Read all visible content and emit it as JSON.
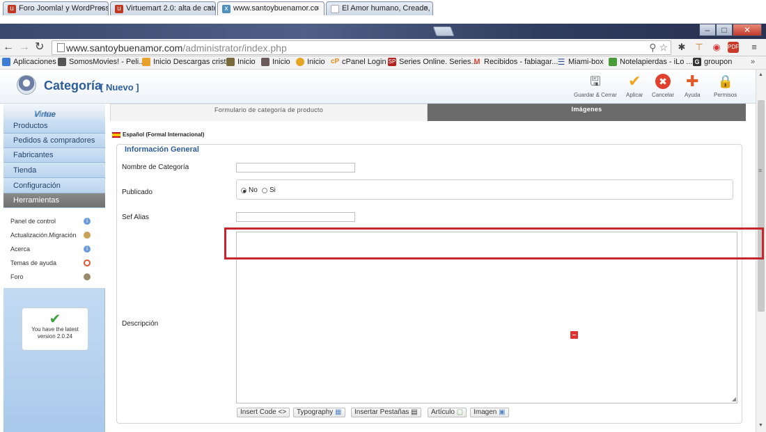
{
  "browser": {
    "tabs": [
      {
        "title": "Foro Joomla! y WordPress",
        "fav": "u",
        "fav_color": "#c3361f"
      },
      {
        "title": "Virtuemart 2.0: alta de cate",
        "fav": "u",
        "fav_color": "#c3361f"
      },
      {
        "title": "www.santoybuenamor.co",
        "fav": "x",
        "fav_color": "#4f8fbf"
      },
      {
        "title": "El Amor humano, Creado,",
        "fav": "",
        "fav_color": "#bbb"
      }
    ],
    "url_host": "www.santoybuenamor.com",
    "url_path": "/administrator/index.php",
    "bookmarks": [
      {
        "label": "Aplicaciones",
        "icon": "apps-icon",
        "color": "#3b7dd8"
      },
      {
        "label": "SomosMovies! - Peli...",
        "icon": "movie-icon",
        "color": "#555"
      },
      {
        "label": "Inicio Descargas cristo",
        "icon": "folder-icon",
        "color": "#e8a22b"
      },
      {
        "label": "Inicio",
        "icon": "site-icon",
        "color": "#7a6a3a"
      },
      {
        "label": "Inicio",
        "icon": "site-icon",
        "color": "#6a5a5a"
      },
      {
        "label": "Inicio",
        "icon": "joomla-icon",
        "color": "#e5a624"
      },
      {
        "label": "cPanel Login",
        "icon": "cpanel-icon",
        "color": "#f08a1c"
      },
      {
        "label": "Series Online. Series...",
        "icon": "sp-icon",
        "color": "#b3221e"
      },
      {
        "label": "Recibidos - fabiagar...",
        "icon": "gmail-icon",
        "color": "#d44638"
      },
      {
        "label": "Miami-box",
        "icon": "box-icon",
        "color": "#2c4c9e"
      },
      {
        "label": "Notelapierdas - iLo ...",
        "icon": "note-icon",
        "color": "#4a9a3a"
      },
      {
        "label": "groupon",
        "icon": "groupon-icon",
        "color": "#333"
      }
    ],
    "bookmarks_more": "»"
  },
  "header": {
    "title": "Categoría",
    "subtitle": "[ Nuevo ]",
    "toolbar": [
      {
        "label": "Guardar & Cerrar",
        "icon": "save-icon",
        "glyph": "🖫",
        "color": "#555"
      },
      {
        "label": "Aplicar",
        "icon": "check-icon",
        "glyph": "✔",
        "color": "#f0a51e"
      },
      {
        "label": "Cancelar",
        "icon": "cancel-icon",
        "glyph": "✖",
        "color": "#e0402c"
      },
      {
        "label": "Ayuda",
        "icon": "help-icon",
        "glyph": "✚",
        "color": "#e05a2a"
      },
      {
        "label": "Permisos",
        "icon": "lock-icon",
        "glyph": "🔒",
        "color": "#999"
      }
    ]
  },
  "sidebar": {
    "logo": "VirtueMart",
    "logo_main": "Virtue",
    "logo_light": "Mart",
    "nav": [
      "Productos",
      "Pedidos & compradores",
      "Fabricantes",
      "Tienda",
      "Configuración",
      "Herramientas"
    ],
    "tools": [
      {
        "label": "Panel de control",
        "icon": "info-icon",
        "color": "#6a9ad8"
      },
      {
        "label": "Actualización.Migración",
        "icon": "package-icon",
        "color": "#c9a15a"
      },
      {
        "label": "Acerca",
        "icon": "info-icon",
        "color": "#6a9ad8"
      },
      {
        "label": "Temas de ayuda",
        "icon": "lifebuoy-icon",
        "color": "#e2552f"
      },
      {
        "label": "Foro",
        "icon": "users-icon",
        "color": "#9a8a6a"
      }
    ],
    "latest": "You have the latest version 2.0.24"
  },
  "content": {
    "tab_form": "Formulario de categoría de producto",
    "tab_images": "Imágenes",
    "language": "Español (Formal Internacional)",
    "section": "Información General",
    "fields": {
      "name_label": "Nombre de Categoría",
      "published_label": "Publicado",
      "radio_no": "No",
      "radio_si": "Si",
      "alias_label": "Sef Alias",
      "description_label": "Descripción"
    },
    "editor_buttons": [
      {
        "label": "Insert Code",
        "glyph": "<>"
      },
      {
        "label": "Typography",
        "glyph": "▦"
      },
      {
        "label": "Insertar Pestañas",
        "glyph": "▤"
      },
      {
        "label": "Artículo",
        "glyph": "▢"
      },
      {
        "label": "Imagen",
        "glyph": "▣"
      }
    ]
  }
}
